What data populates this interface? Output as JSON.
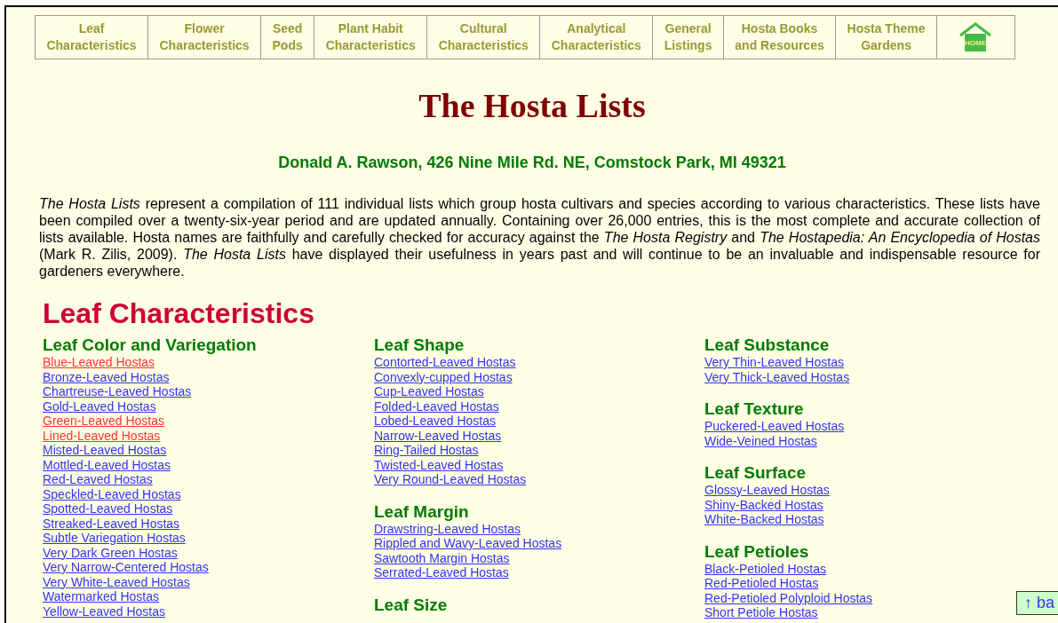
{
  "nav": [
    {
      "kind": "text",
      "lines": [
        "Leaf",
        "Characteristics"
      ]
    },
    {
      "kind": "text",
      "lines": [
        "Flower",
        "Characteristics"
      ]
    },
    {
      "kind": "text",
      "lines": [
        "Seed",
        "Pods"
      ]
    },
    {
      "kind": "text",
      "lines": [
        "Plant Habit",
        "Characteristics"
      ]
    },
    {
      "kind": "text",
      "lines": [
        "Cultural",
        "Characteristics"
      ]
    },
    {
      "kind": "text",
      "lines": [
        "Analytical",
        "Characteristics"
      ]
    },
    {
      "kind": "text",
      "lines": [
        "General",
        "Listings"
      ]
    },
    {
      "kind": "text",
      "lines": [
        "Hosta Books",
        "and Resources"
      ]
    },
    {
      "kind": "text",
      "lines": [
        "Hosta Theme",
        "Gardens"
      ]
    },
    {
      "kind": "home",
      "label": "HOME"
    }
  ],
  "title": "The Hosta Lists",
  "subtitle": "Donald A. Rawson, 426 Nine Mile Rd. NE, Comstock Park, MI 49321",
  "intro": "*The Hosta Lists* represent a compilation of 111 individual lists which group hosta cultivars and species according to various characteristics. These lists have been compiled over a twenty-six-year period and are updated annually. Containing over 26,000 entries, this is the most complete and accurate collection of lists available. Hosta names are faithfully and carefully checked for accuracy against the *The Hosta Registry* and *The Hostapedia: An Encyclopedia of Hostas* (Mark R. Zilis, 2009). *The Hosta Lists* have displayed their usefulness in years past and will continue to be an invaluable and indispensable resource for gardeners everywhere.",
  "section": "Leaf Characteristics",
  "columns": [
    [
      {
        "heading": "Leaf Color and Variegation",
        "links": [
          {
            "text": "Blue-Leaved Hostas",
            "visited": true
          },
          {
            "text": "Bronze-Leaved Hostas",
            "visited": false
          },
          {
            "text": "Chartreuse-Leaved Hostas",
            "visited": false
          },
          {
            "text": "Gold-Leaved Hostas",
            "visited": false
          },
          {
            "text": "Green-Leaved Hostas",
            "visited": true
          },
          {
            "text": "Lined-Leaved Hostas",
            "visited": true
          },
          {
            "text": "Misted-Leaved Hostas",
            "visited": false
          },
          {
            "text": "Mottled-Leaved Hostas",
            "visited": false
          },
          {
            "text": "Red-Leaved Hostas",
            "visited": false
          },
          {
            "text": "Speckled-Leaved Hostas",
            "visited": false
          },
          {
            "text": "Spotted-Leaved Hostas",
            "visited": false
          },
          {
            "text": "Streaked-Leaved Hostas",
            "visited": false
          },
          {
            "text": "Subtle Variegation Hostas",
            "visited": false
          },
          {
            "text": "Very Dark Green Hostas",
            "visited": false
          },
          {
            "text": "Very Narrow-Centered Hostas",
            "visited": false
          },
          {
            "text": "Very White-Leaved Hostas",
            "visited": false
          },
          {
            "text": "Watermarked Hostas",
            "visited": false
          },
          {
            "text": "Yellow-Leaved Hostas",
            "visited": false
          }
        ]
      }
    ],
    [
      {
        "heading": "Leaf Shape",
        "links": [
          {
            "text": "Contorted-Leaved Hostas",
            "visited": false
          },
          {
            "text": "Convexly-cupped Hostas",
            "visited": false
          },
          {
            "text": "Cup-Leaved Hostas",
            "visited": false
          },
          {
            "text": "Folded-Leaved Hostas",
            "visited": false
          },
          {
            "text": "Lobed-Leaved Hostas",
            "visited": false
          },
          {
            "text": "Narrow-Leaved Hostas",
            "visited": false
          },
          {
            "text": "Ring-Tailed Hostas",
            "visited": false
          },
          {
            "text": "Twisted-Leaved Hostas",
            "visited": false
          },
          {
            "text": "Very Round-Leaved Hostas",
            "visited": false
          }
        ]
      },
      {
        "heading": "Leaf Margin",
        "links": [
          {
            "text": "Drawstring-Leaved Hostas",
            "visited": false
          },
          {
            "text": "Rippled and Wavy-Leaved Hostas",
            "visited": false
          },
          {
            "text": "Sawtooth Margin Hostas",
            "visited": false
          },
          {
            "text": "Serrated-Leaved Hostas",
            "visited": false
          }
        ]
      },
      {
        "heading": "Leaf Size"
      }
    ],
    [
      {
        "heading": "Leaf Substance",
        "links": [
          {
            "text": "Very Thin-Leaved Hostas",
            "visited": false
          },
          {
            "text": "Very Thick-Leaved Hostas",
            "visited": false
          }
        ]
      },
      {
        "heading": "Leaf Texture",
        "links": [
          {
            "text": "Puckered-Leaved Hostas",
            "visited": false
          },
          {
            "text": "Wide-Veined Hostas",
            "visited": false
          }
        ]
      },
      {
        "heading": "Leaf Surface",
        "links": [
          {
            "text": "Glossy-Leaved Hostas",
            "visited": false
          },
          {
            "text": "Shiny-Backed Hostas",
            "visited": false
          },
          {
            "text": "White-Backed Hostas",
            "visited": false
          }
        ]
      },
      {
        "heading": "Leaf Petioles",
        "links": [
          {
            "text": "Black-Petioled Hostas",
            "visited": false
          },
          {
            "text": "Red-Petioled Hostas",
            "visited": false
          },
          {
            "text": "Red-Petioled Polyploid Hostas",
            "visited": false
          },
          {
            "text": "Short Petiole Hostas",
            "visited": false
          }
        ]
      }
    ]
  ],
  "back_button": "↑ ba"
}
